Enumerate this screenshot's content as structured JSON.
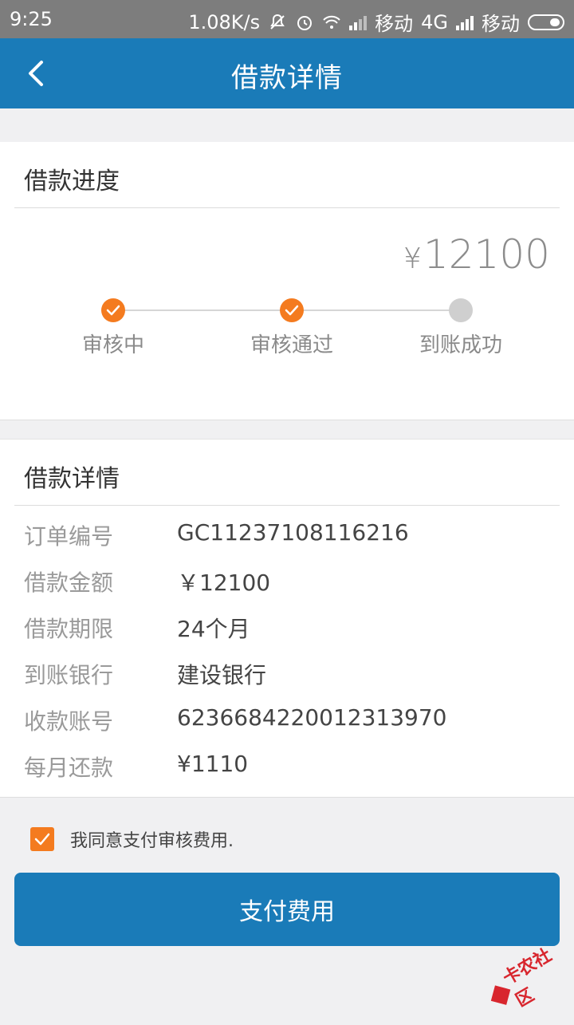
{
  "status_bar": {
    "time": "9:25",
    "speed": "1.08K/s",
    "carrier1": "移动",
    "network": "4G",
    "carrier2": "移动"
  },
  "app_bar": {
    "title": "借款详情",
    "back_icon": "chevron-left-icon"
  },
  "progress": {
    "section_title": "借款进度",
    "amount_symbol": "¥",
    "amount": "12100",
    "steps": [
      {
        "label": "审核中",
        "status": "done"
      },
      {
        "label": "审核通过",
        "status": "done"
      },
      {
        "label": "到账成功",
        "status": "pending"
      }
    ]
  },
  "details": {
    "section_title": "借款详情",
    "rows": [
      {
        "key": "订单编号",
        "value": "GC11237108116216"
      },
      {
        "key": "借款金额",
        "value": "￥12100"
      },
      {
        "key": "借款期限",
        "value": "24个月"
      },
      {
        "key": "到账银行",
        "value": "建设银行"
      },
      {
        "key": "收款账号",
        "value": "6236684220012313970"
      },
      {
        "key": "每月还款",
        "value": "¥1110"
      }
    ]
  },
  "agreement": {
    "checked": true,
    "text": "我同意支付审核费用."
  },
  "pay_button": {
    "label": "支付费用"
  },
  "watermark": {
    "text": "卡农社区"
  },
  "colors": {
    "primary": "#1a7bb8",
    "accent": "#f47b1f",
    "pending": "#cfcfcf"
  }
}
